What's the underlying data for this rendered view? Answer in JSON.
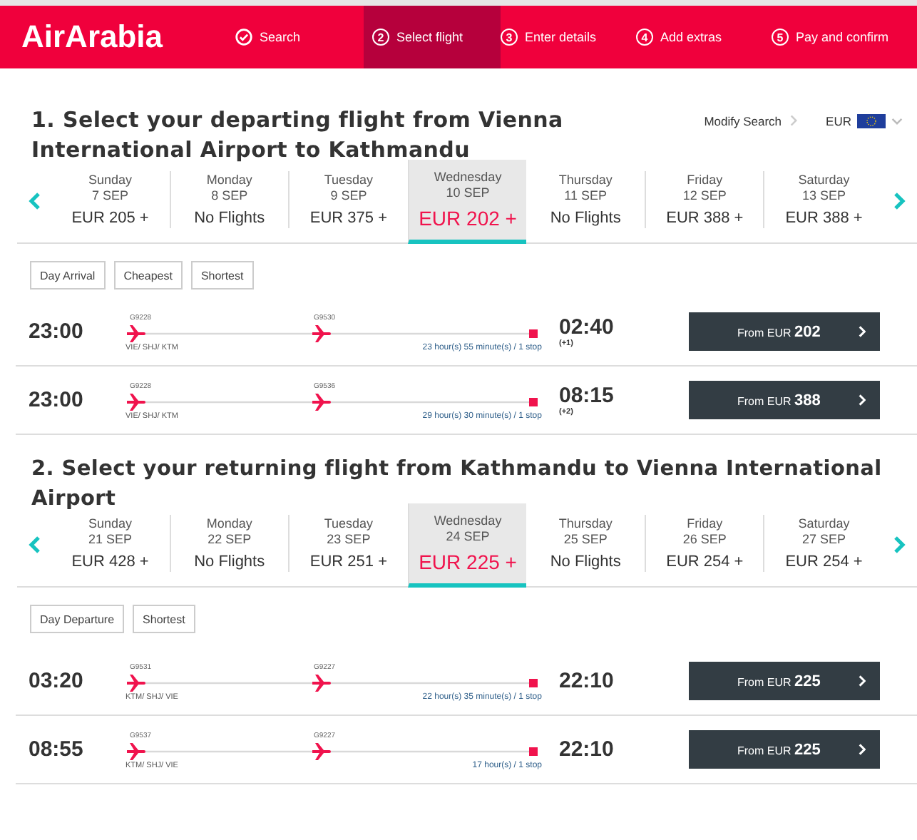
{
  "header": {
    "logo": "AirArabia",
    "steps": [
      {
        "kind": "done",
        "label": "Search",
        "selected": false
      },
      {
        "kind": "numbered",
        "number": "2",
        "label": "Select flight",
        "selected": true
      },
      {
        "kind": "numbered",
        "number": "3",
        "label": "Enter details",
        "selected": false
      },
      {
        "kind": "numbered",
        "number": "4",
        "label": "Add extras",
        "selected": false
      },
      {
        "kind": "numbered",
        "number": "5",
        "label": "Pay and confirm",
        "selected": false
      }
    ]
  },
  "toolbar": {
    "modify_search": "Modify Search",
    "currency": "EUR"
  },
  "sections": [
    {
      "title": "1. Select your departing flight from Vienna International Airport to Kathmandu",
      "dates": [
        {
          "day": "Sunday",
          "date": "7 SEP",
          "price": "EUR 205 +",
          "selected": false
        },
        {
          "day": "Monday",
          "date": "8 SEP",
          "price": "No Flights",
          "selected": false
        },
        {
          "day": "Tuesday",
          "date": "9 SEP",
          "price": "EUR 375 +",
          "selected": false
        },
        {
          "day": "Wednesday",
          "date": "10 SEP",
          "price": "EUR 202 +",
          "selected": true
        },
        {
          "day": "Thursday",
          "date": "11 SEP",
          "price": "No Flights",
          "selected": false
        },
        {
          "day": "Friday",
          "date": "12 SEP",
          "price": "EUR 388 +",
          "selected": false
        },
        {
          "day": "Saturday",
          "date": "13 SEP",
          "price": "EUR 388 +",
          "selected": false
        }
      ],
      "filters": [
        "Day Arrival",
        "Cheapest",
        "Shortest"
      ],
      "flights": [
        {
          "depart": "23:00",
          "arrive": "02:40",
          "day_offset": "(+1)",
          "codes": [
            "G9228",
            "G9530"
          ],
          "route": "VIE/ SHJ/ KTM",
          "duration": "23 hour(s) 55 minute(s) / 1 stop",
          "price": "From EUR **202**"
        },
        {
          "depart": "23:00",
          "arrive": "08:15",
          "day_offset": "(+2)",
          "codes": [
            "G9228",
            "G9536"
          ],
          "route": "VIE/ SHJ/ KTM",
          "duration": "29 hour(s) 30 minute(s) / 1 stop",
          "price": "From EUR **388**"
        }
      ]
    },
    {
      "title": "2. Select your returning flight from Kathmandu to Vienna International Airport",
      "dates": [
        {
          "day": "Sunday",
          "date": "21 SEP",
          "price": "EUR 428 +",
          "selected": false
        },
        {
          "day": "Monday",
          "date": "22 SEP",
          "price": "No Flights",
          "selected": false
        },
        {
          "day": "Tuesday",
          "date": "23 SEP",
          "price": "EUR 251 +",
          "selected": false
        },
        {
          "day": "Wednesday",
          "date": "24 SEP",
          "price": "EUR 225 +",
          "selected": true
        },
        {
          "day": "Thursday",
          "date": "25 SEP",
          "price": "No Flights",
          "selected": false
        },
        {
          "day": "Friday",
          "date": "26 SEP",
          "price": "EUR 254 +",
          "selected": false
        },
        {
          "day": "Saturday",
          "date": "27 SEP",
          "price": "EUR 254 +",
          "selected": false
        }
      ],
      "filters": [
        "Day Departure",
        "Shortest"
      ],
      "flights": [
        {
          "depart": "03:20",
          "arrive": "22:10",
          "codes": [
            "G9531",
            "G9227"
          ],
          "route": "KTM/ SHJ/ VIE",
          "duration": "22 hour(s) 35 minute(s) / 1 stop",
          "price": "From EUR **225**"
        },
        {
          "depart": "08:55",
          "arrive": "22:10",
          "codes": [
            "G9537",
            "G9227"
          ],
          "route": "KTM/ SHJ/ VIE",
          "duration": "17 hour(s) / 1 stop",
          "price": "From EUR **225**"
        }
      ]
    }
  ]
}
